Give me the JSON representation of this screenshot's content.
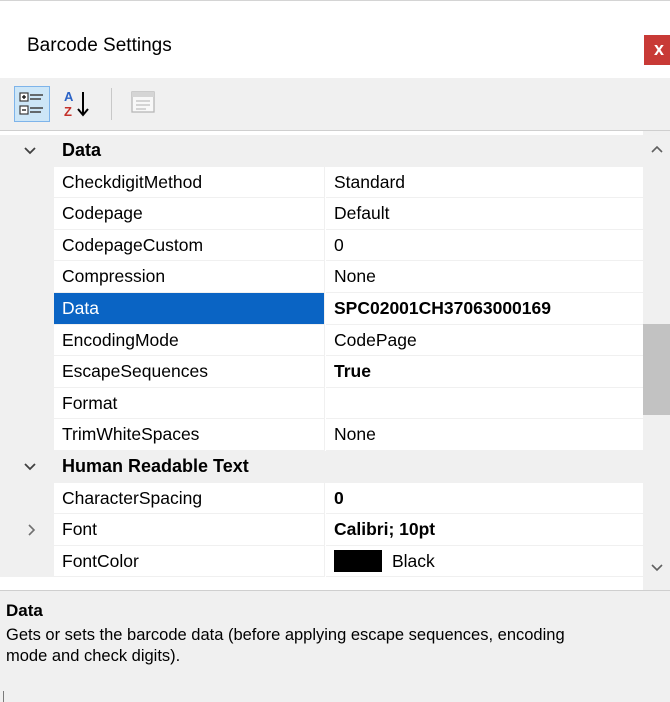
{
  "window": {
    "title": "Barcode Settings",
    "close_label": "x"
  },
  "toolbar": {
    "categorized_icon": "categorized-view-icon",
    "alphabetical_icon": "alphabetical-sort-icon",
    "property_pages_icon": "property-pages-icon",
    "selected_color": "#cde6f7"
  },
  "categories": [
    {
      "label": "Data",
      "expanded": true,
      "properties": [
        {
          "name": "CheckdigitMethod",
          "value": "Standard",
          "bold": false
        },
        {
          "name": "Codepage",
          "value": "Default",
          "bold": false
        },
        {
          "name": "CodepageCustom",
          "value": "0",
          "bold": false
        },
        {
          "name": "Compression",
          "value": "None",
          "bold": false
        },
        {
          "name": "Data",
          "value": "SPC02001CH37063000169",
          "bold": true,
          "selected": true
        },
        {
          "name": "EncodingMode",
          "value": "CodePage",
          "bold": false
        },
        {
          "name": "EscapeSequences",
          "value": "True",
          "bold": true
        },
        {
          "name": "Format",
          "value": "",
          "bold": false
        },
        {
          "name": "TrimWhiteSpaces",
          "value": "None",
          "bold": false
        }
      ]
    },
    {
      "label": "Human Readable Text",
      "expanded": true,
      "properties": [
        {
          "name": "CharacterSpacing",
          "value": "0",
          "bold": true
        },
        {
          "name": "Font",
          "value": "Calibri; 10pt",
          "bold": true,
          "expandable": true
        },
        {
          "name": "FontColor",
          "value": "Black",
          "bold": false,
          "swatch": "#000000"
        }
      ]
    }
  ],
  "help": {
    "title": "Data",
    "description": "Gets or sets the barcode data (before applying escape sequences, encoding mode and check digits)."
  },
  "colors": {
    "selection": "#0a64c4",
    "close": "#c83a36",
    "panel": "#f0f0f0"
  }
}
